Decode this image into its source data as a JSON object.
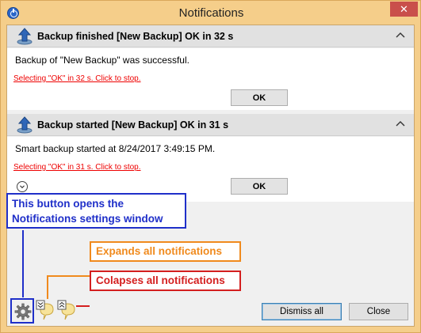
{
  "window": {
    "title": "Notifications",
    "close_glyph": "✕"
  },
  "notifications": [
    {
      "heading": "Backup finished [New Backup] OK in 32 s",
      "message": "Backup of \"New Backup\" was successful.",
      "countdown_link": "Selecting \"OK\" in 32 s. Click to stop.",
      "ok_label": "OK",
      "icon": "upload-arrow-icon"
    },
    {
      "heading": "Backup started [New Backup] OK in 31 s",
      "message": "Smart backup started at 8/24/2017 3:49:15 PM.",
      "countdown_link": "Selecting \"OK\" in 31 s. Click to stop.",
      "ok_label": "OK",
      "icon": "upload-arrow-icon"
    }
  ],
  "annotations": {
    "settings_line1": "This button opens the",
    "settings_line2": "Notifications settings window",
    "expand": "Expands all notifications",
    "collapse": "Colapses all notifications"
  },
  "footer": {
    "dismiss_label": "Dismiss all",
    "close_label": "Close"
  },
  "colors": {
    "frame": "#f5ce8a",
    "annotation_blue": "#1f2fc9",
    "annotation_orange": "#f08a1d",
    "annotation_red": "#d41f1f",
    "link_red": "#e00000"
  }
}
